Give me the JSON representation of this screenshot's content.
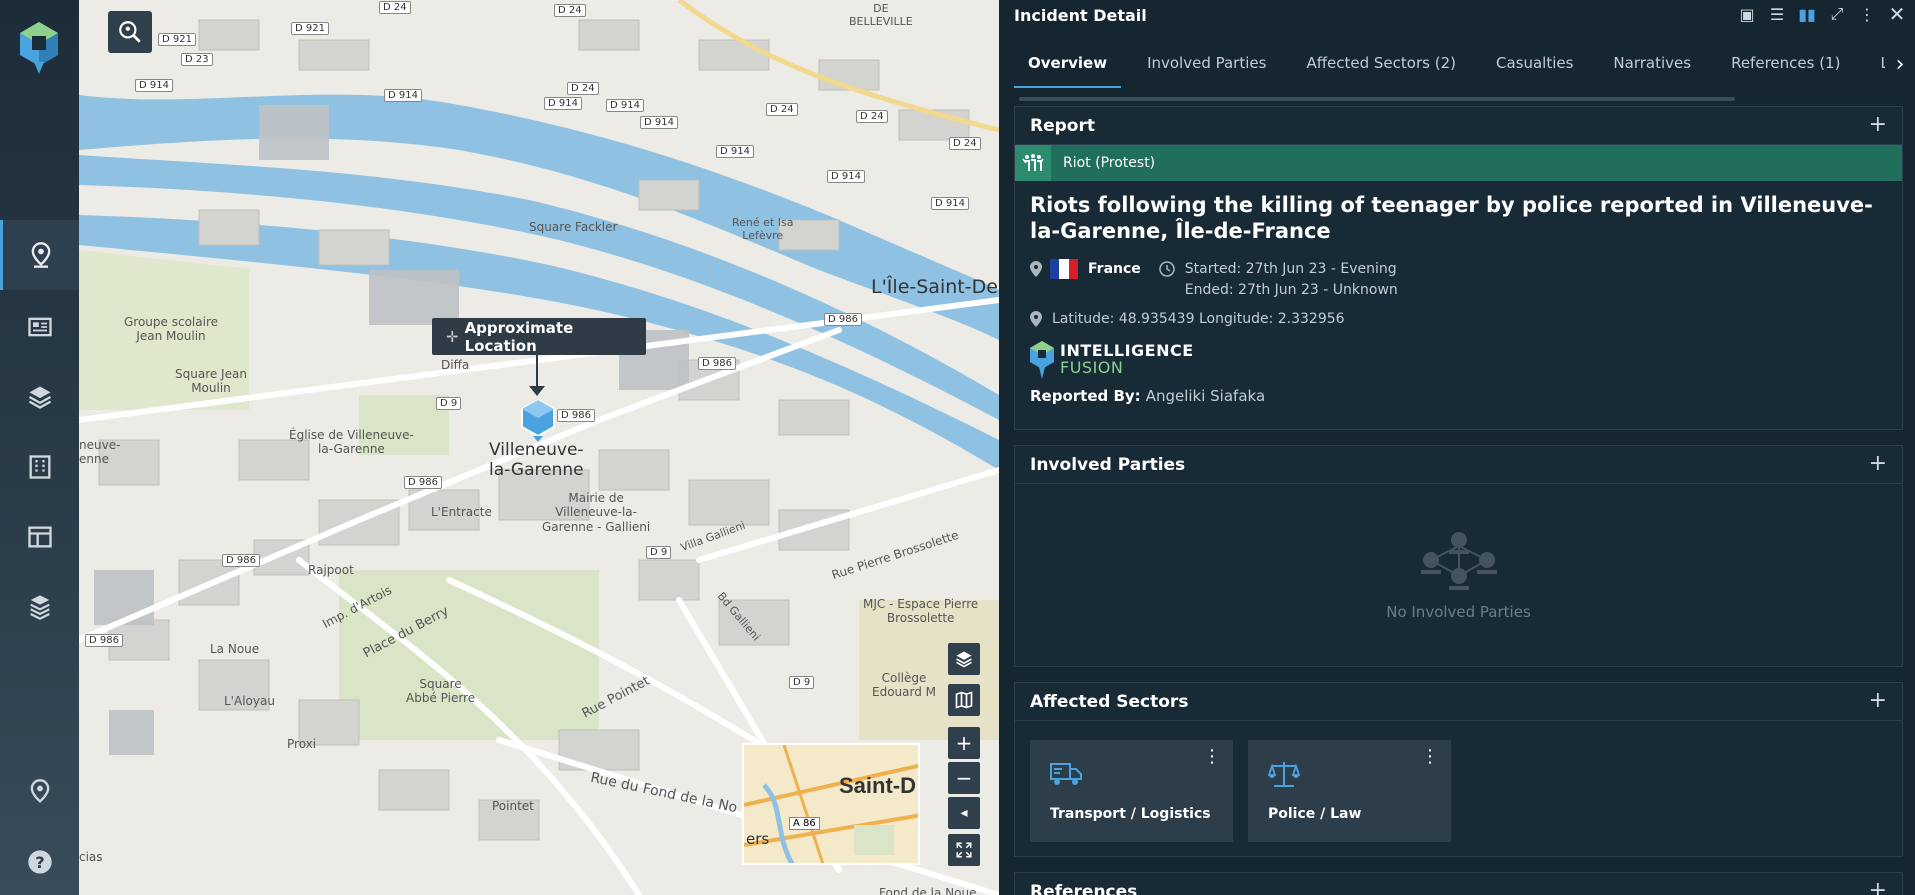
{
  "panel": {
    "title": "Incident Detail",
    "tabs": [
      "Overview",
      "Involved Parties",
      "Affected Sectors (2)",
      "Casualties",
      "Narratives",
      "References (1)",
      "Links"
    ]
  },
  "report": {
    "heading": "Report",
    "category": "Riot (Protest)",
    "title": "Riots following the killing of teenager by police reported in Villeneuve-la-Garenne, Île-de-France",
    "country": "France",
    "started": "Started: 27th Jun 23 - Evening",
    "ended": "Ended: 27th Jun 23 - Unknown",
    "coordinates": "Latitude: 48.935439 Longitude: 2.332956",
    "logo_line1": "INTELLIGENCE",
    "logo_line2": "FUSION",
    "reported_by_label": "Reported By:",
    "reported_by": "Angeliki Siafaka"
  },
  "involved_parties": {
    "heading": "Involved Parties",
    "empty": "No Involved Parties"
  },
  "affected_sectors": {
    "heading": "Affected Sectors",
    "items": [
      {
        "label": "Transport / Logistics",
        "icon": "truck-icon"
      },
      {
        "label": "Police / Law",
        "icon": "scales-icon"
      }
    ]
  },
  "references": {
    "heading": "References"
  },
  "map": {
    "tooltip": "Approximate Location",
    "place_labels": {
      "villeneuve": "Villeneuve-\nla-Garenne",
      "ile_saint_denis": "L'Île-Saint-Den",
      "belleville": "DE\nBELLEVILLE",
      "square_fackler": "Square Fackler",
      "rene_lefevre": "René et Isa\nLefèvre",
      "groupe_scolaire": "Groupe scolaire\nJean Moulin",
      "square_jean_moulin": "Square Jean\nMoulin",
      "diffa": "Diffa",
      "eglise": "Église de Villeneuve-\nla-Garenne",
      "ville_neuve": "neuve-\nenne",
      "mairie": "Mairie de\nVilleneuve-la-\nGarenne - Gallieni",
      "entracte": "L'Entracte",
      "rajpoot": "Rajpoot",
      "la_noue": "La Noue",
      "aloyau": "L'Aloyau",
      "proxi": "Proxi",
      "square_abbe": "Square\nAbbé Pierre",
      "mjc": "MJC - Espace Pierre\nBrossolette",
      "college": "Collège\nEdouard M",
      "pointet": "Pointet",
      "cias": "cias",
      "fond_noue": "Fond de la Noue",
      "minimap_city": "Saint-D",
      "minimap_sub": "ers",
      "minimap_road": "A 86"
    },
    "road_badges": [
      "D 24",
      "D 921",
      "D 24",
      "D 23",
      "D 921",
      "D 914",
      "D 914",
      "D 914",
      "D 914",
      "D 24",
      "D 914",
      "D 24",
      "D 914",
      "D 24",
      "D 24",
      "D 914",
      "D 914",
      "D 986",
      "D 986",
      "D 986",
      "D 9",
      "D 986",
      "D 986",
      "D 9",
      "D 986",
      "D 9",
      "D 986"
    ],
    "street_labels": [
      "Rue Pointet",
      "Rue du Fond de la No",
      "Place du Berry",
      "Imp. d'Artois",
      "Rue Pierre Brossolette",
      "Villa Gallieni",
      "Bd Gallieni"
    ]
  },
  "colors": {
    "accent": "#4aa3df",
    "category_green": "#1f6f5c",
    "panel_bg": "#162631",
    "water": "#8fc1e3"
  }
}
